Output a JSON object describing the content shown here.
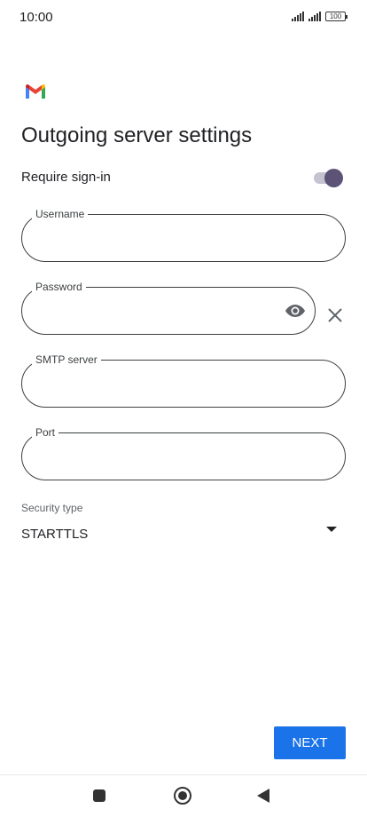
{
  "status_bar": {
    "time": "10:00",
    "battery": "100",
    "icons": [
      "signal-icon",
      "signal-icon",
      "battery-icon"
    ]
  },
  "app": {
    "logo": "gmail-logo",
    "colors": {
      "red": "#EA4335",
      "blue": "#4285F4",
      "green": "#34A853",
      "yellow": "#FBBC04"
    }
  },
  "page": {
    "title": "Outgoing server settings"
  },
  "require_signin": {
    "label": "Require sign-in",
    "enabled": true
  },
  "fields": {
    "username": {
      "label": "Username",
      "value": ""
    },
    "password": {
      "label": "Password",
      "value": ""
    },
    "smtp_server": {
      "label": "SMTP server",
      "value": ""
    },
    "port": {
      "label": "Port",
      "value": ""
    }
  },
  "security_type": {
    "label": "Security type",
    "value": "STARTTLS"
  },
  "actions": {
    "next_label": "NEXT"
  },
  "colors": {
    "accent": "#1a73e8",
    "toggle_thumb": "#5c5377",
    "toggle_track": "#c5c3cf"
  },
  "nav": {
    "icons": [
      "recents-icon",
      "home-icon",
      "back-icon"
    ]
  }
}
